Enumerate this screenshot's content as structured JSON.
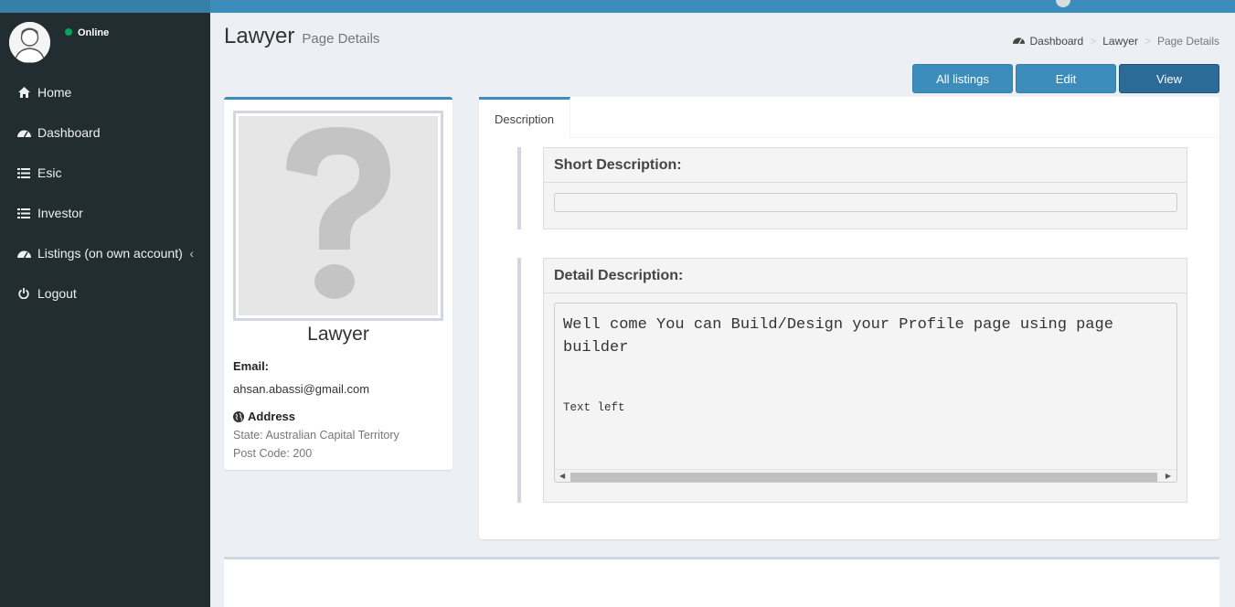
{
  "sidebar": {
    "user_status": "Online",
    "menu": [
      {
        "label": "Home",
        "icon": "home-icon"
      },
      {
        "label": "Dashboard",
        "icon": "dashboard-icon"
      },
      {
        "label": "Esic",
        "icon": "list-icon"
      },
      {
        "label": "Investor",
        "icon": "list-icon"
      },
      {
        "label": "Listings (on own account)",
        "icon": "dashboard-icon",
        "has_submenu": true
      },
      {
        "label": "Logout",
        "icon": "power-icon"
      }
    ]
  },
  "header": {
    "title": "Lawyer",
    "subtitle": "Page Details"
  },
  "breadcrumb": {
    "items": [
      "Dashboard",
      "Lawyer",
      "Page Details"
    ]
  },
  "actions": {
    "all_listings": "All listings",
    "edit": "Edit",
    "view": "View"
  },
  "profile": {
    "name": "Lawyer",
    "email_label": "Email:",
    "email": "ahsan.abassi@gmail.com",
    "address_label": "Address",
    "state": "State: Australian Capital Territory",
    "post_code": "Post Code: 200"
  },
  "tabs": {
    "description": "Description"
  },
  "short_description": {
    "heading": "Short Description:",
    "value": ""
  },
  "detail_description": {
    "heading": "Detail Description:",
    "line1": "Well come You can Build/Design your Profile page using page",
    "line2": "builder",
    "text_left": "Text left"
  },
  "colors": {
    "primary": "#3c8dbc",
    "sidebar_bg": "#222d32",
    "arrow": "#ff0000",
    "online": "#00a65a"
  }
}
